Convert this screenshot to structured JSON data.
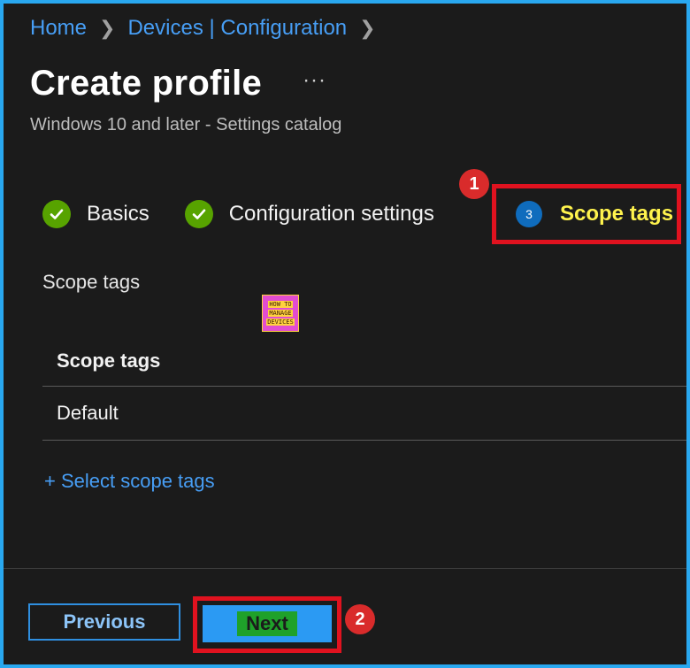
{
  "breadcrumb": {
    "items": [
      "Home",
      "Devices | Configuration"
    ]
  },
  "header": {
    "title": "Create profile",
    "more": "···",
    "subtitle": "Windows 10 and later - Settings catalog"
  },
  "steps": {
    "items": [
      {
        "label": "Basics",
        "status": "complete"
      },
      {
        "label": "Configuration settings",
        "status": "complete"
      }
    ],
    "current": {
      "number": "3",
      "label": "Scope tags"
    }
  },
  "callouts": {
    "first": "1",
    "second": "2"
  },
  "section": {
    "label": "Scope tags"
  },
  "logo": {
    "line1": "HOW TO",
    "line2": "MANAGE",
    "line3": "DEVICES"
  },
  "table": {
    "header": "Scope tags",
    "rows": [
      "Default"
    ]
  },
  "actions": {
    "select_scope_tags": "+ Select scope tags",
    "previous": "Previous",
    "next": "Next"
  },
  "colors": {
    "accent": "#479ef5",
    "check": "#57a300",
    "highlight": "#e0121f",
    "current_label": "#fff34d"
  }
}
